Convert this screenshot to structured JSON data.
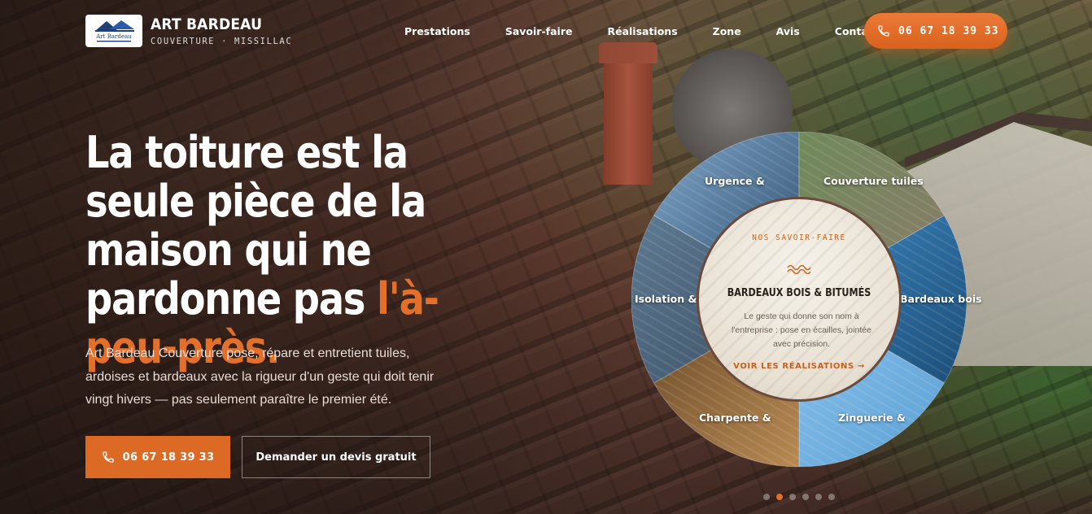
{
  "brand": {
    "name": "ART BARDEAU",
    "tagline": "COUVERTURE · MISSILLAC",
    "logo_text": "Art Bardeau"
  },
  "nav": {
    "items": [
      {
        "label": "Prestations"
      },
      {
        "label": "Savoir-faire"
      },
      {
        "label": "Réalisations"
      },
      {
        "label": "Zone"
      },
      {
        "label": "Avis"
      },
      {
        "label": "Contact"
      }
    ]
  },
  "header_cta": {
    "phone": "06 67 18 39 33",
    "icon": "phone-icon"
  },
  "hero": {
    "title_part1": "La toiture est la seule pièce de la maison qui ne pardonne pas ",
    "title_accent": "l'à-peu-près.",
    "description": "Art Bardeau Couverture pose, répare et entretient tuiles, ardoises et bardeaux avec la rigueur d'un geste qui doit tenir vingt hivers — pas seulement paraître le premier été.",
    "primary_button": "06 67 18 39 33",
    "secondary_button": "Demander un devis gratuit"
  },
  "wheel": {
    "segments": [
      {
        "label": "Urgence &"
      },
      {
        "label": "Couverture tuiles"
      },
      {
        "label": "Bardeaux bois"
      },
      {
        "label": "Zinguerie &"
      },
      {
        "label": "Charpente &"
      },
      {
        "label": "Isolation &"
      }
    ],
    "center": {
      "eyebrow": "NOS SAVOIR-FAIRE",
      "title": "BARDEAUX BOIS & BITUMÉS",
      "text": "Le geste qui donne son nom à l'entreprise : pose en écailles, jointée avec précision.",
      "link": "VOIR LES RÉALISATIONS →"
    }
  },
  "pager": {
    "count": 6,
    "active_index": 1
  },
  "colors": {
    "accent": "#dd6a24",
    "accent_light": "#ec7a36",
    "text": "#ffffff"
  }
}
